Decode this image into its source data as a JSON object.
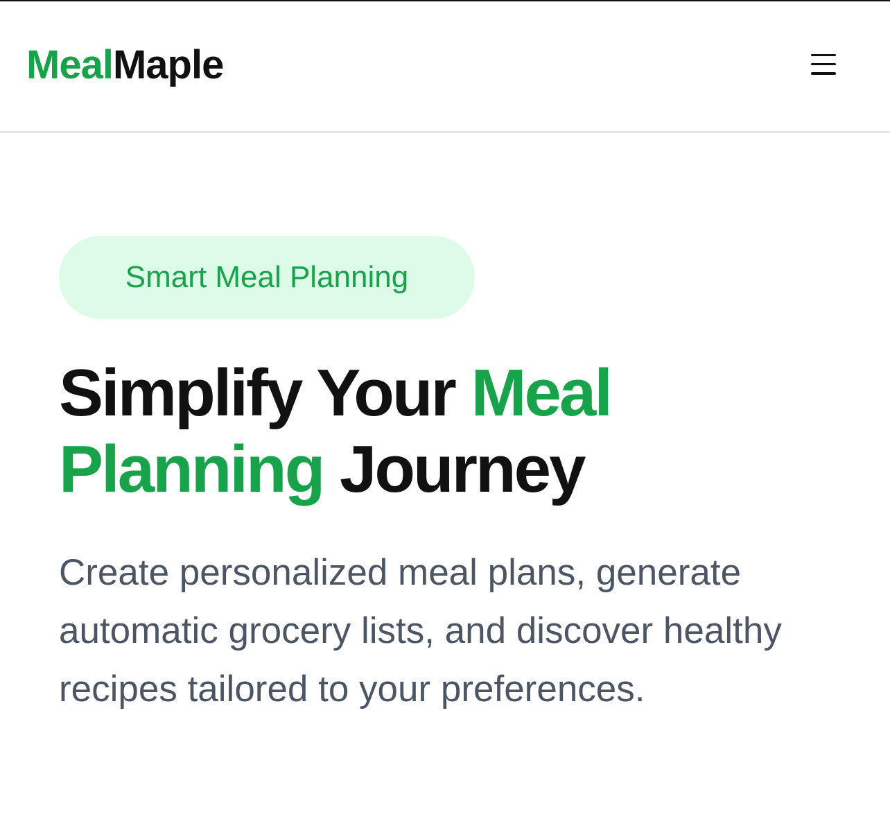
{
  "header": {
    "logo_part1": "Meal",
    "logo_part2": "Maple",
    "menu_icon": "hamburger-menu-icon"
  },
  "hero": {
    "badge": "Smart Meal Planning",
    "title_part1": "Simplify Your ",
    "title_accent1": "Meal",
    "title_accent2": "Planning",
    "title_part2": " Journey",
    "subtitle": "Create personalized meal plans, generate automatic grocery lists, and discover healthy recipes tailored to your preferences."
  },
  "colors": {
    "accent": "#16a34a",
    "badge_bg": "#dcfce7",
    "text": "#111111",
    "muted": "#4b5563",
    "divider": "#e5e7eb"
  }
}
